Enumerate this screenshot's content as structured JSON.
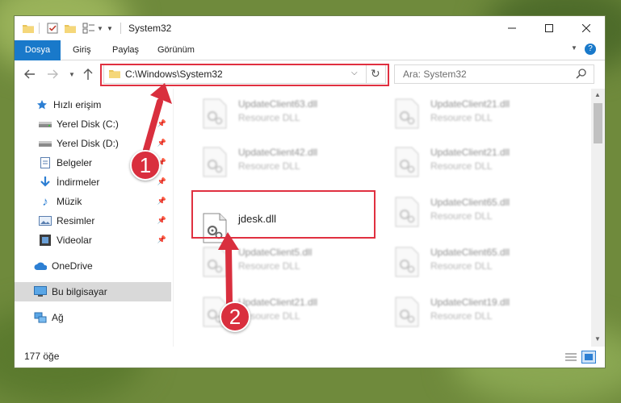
{
  "window": {
    "title": "System32",
    "controls": [
      "minimize",
      "maximize",
      "close"
    ]
  },
  "ribbon": {
    "tabs": [
      {
        "label": "Dosya",
        "active": true
      },
      {
        "label": "Giriş"
      },
      {
        "label": "Paylaş"
      },
      {
        "label": "Görünüm"
      }
    ],
    "help_icon": "question-icon"
  },
  "navigation": {
    "address": "C:\\Windows\\System32",
    "search_placeholder": "Ara: System32"
  },
  "sidebar": {
    "items": [
      {
        "label": "Hızlı erişim",
        "icon": "star-icon",
        "pinned": false
      },
      {
        "label": "Yerel Disk (C:)",
        "icon": "drive-icon",
        "pinned": true
      },
      {
        "label": "Yerel Disk (D:)",
        "icon": "drive-icon",
        "pinned": true
      },
      {
        "label": "Belgeler",
        "icon": "documents-icon",
        "pinned": true
      },
      {
        "label": "İndirmeler",
        "icon": "download-icon",
        "pinned": true
      },
      {
        "label": "Müzik",
        "icon": "music-icon",
        "pinned": true
      },
      {
        "label": "Resimler",
        "icon": "pictures-icon",
        "pinned": true
      },
      {
        "label": "Videolar",
        "icon": "videos-icon",
        "pinned": true
      },
      {
        "label": "OneDrive",
        "icon": "cloud-icon",
        "pinned": false
      },
      {
        "label": "Bu bilgisayar",
        "icon": "computer-icon",
        "pinned": false,
        "selected": true
      },
      {
        "label": "Ağ",
        "icon": "network-icon",
        "pinned": false
      }
    ]
  },
  "files": [
    {
      "name": "UpdateClient63.dll",
      "type": "Resource DLL"
    },
    {
      "name": "UpdateClient21.dll",
      "type": "Resource DLL"
    },
    {
      "name": "UpdateClient42.dll",
      "type": "Resource DLL"
    },
    {
      "name": "UpdateClient21.dll",
      "type": "Resource DLL"
    },
    {
      "name": "jdesk.dll",
      "type": ""
    },
    {
      "name": "UpdateClient65.dll",
      "type": "Resource DLL"
    },
    {
      "name": "UpdateClient5.dll",
      "type": "Resource DLL"
    },
    {
      "name": "UpdateClient65.dll",
      "type": "Resource DLL"
    },
    {
      "name": "UpdateClient21.dll",
      "type": "Resource DLL"
    },
    {
      "name": "UpdateClient19.dll",
      "type": "Resource DLL"
    }
  ],
  "status": {
    "item_count": "177 öğe"
  },
  "annotations": [
    {
      "number": "1",
      "color": "#d92f3e"
    },
    {
      "number": "2",
      "color": "#d92f3e"
    }
  ],
  "colors": {
    "accent": "#1979ca",
    "highlight": "#e03040",
    "selected_bg": "#d9d9d9"
  }
}
